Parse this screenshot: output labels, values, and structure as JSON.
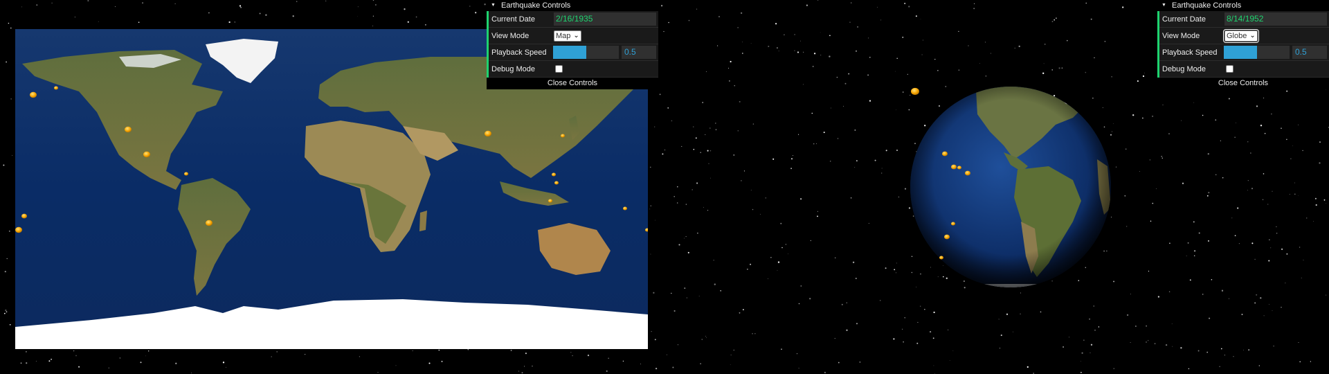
{
  "left_view": {
    "view_name": "map",
    "controls": {
      "title": "Earthquake Controls",
      "current_date_label": "Current Date",
      "current_date_value": "2/16/1935",
      "view_mode_label": "View Mode",
      "view_mode_value": "Map",
      "playback_speed_label": "Playback Speed",
      "playback_speed_value": "0.5",
      "playback_speed_fraction": 0.5,
      "debug_mode_label": "Debug Mode",
      "debug_mode_checked": false,
      "close_label": "Close Controls"
    }
  },
  "right_view": {
    "view_name": "globe",
    "controls": {
      "title": "Earthquake Controls",
      "current_date_label": "Current Date",
      "current_date_value": "8/14/1952",
      "view_mode_label": "View Mode",
      "view_mode_value": "Globe",
      "playback_speed_label": "Playback Speed",
      "playback_speed_value": "0.5",
      "playback_speed_fraction": 0.5,
      "debug_mode_label": "Debug Mode",
      "debug_mode_checked": false,
      "close_label": "Close Controls"
    }
  },
  "colors": {
    "accent_green": "#1ed36f",
    "slider_blue": "#2fa1d6",
    "quake_marker": "#f5a300",
    "ocean": "#0b2a63",
    "land": "#6f7d3c",
    "ice": "#ffffff"
  },
  "icons": {
    "collapse": "triangle-down-icon",
    "select": "chevron-down-icon"
  }
}
